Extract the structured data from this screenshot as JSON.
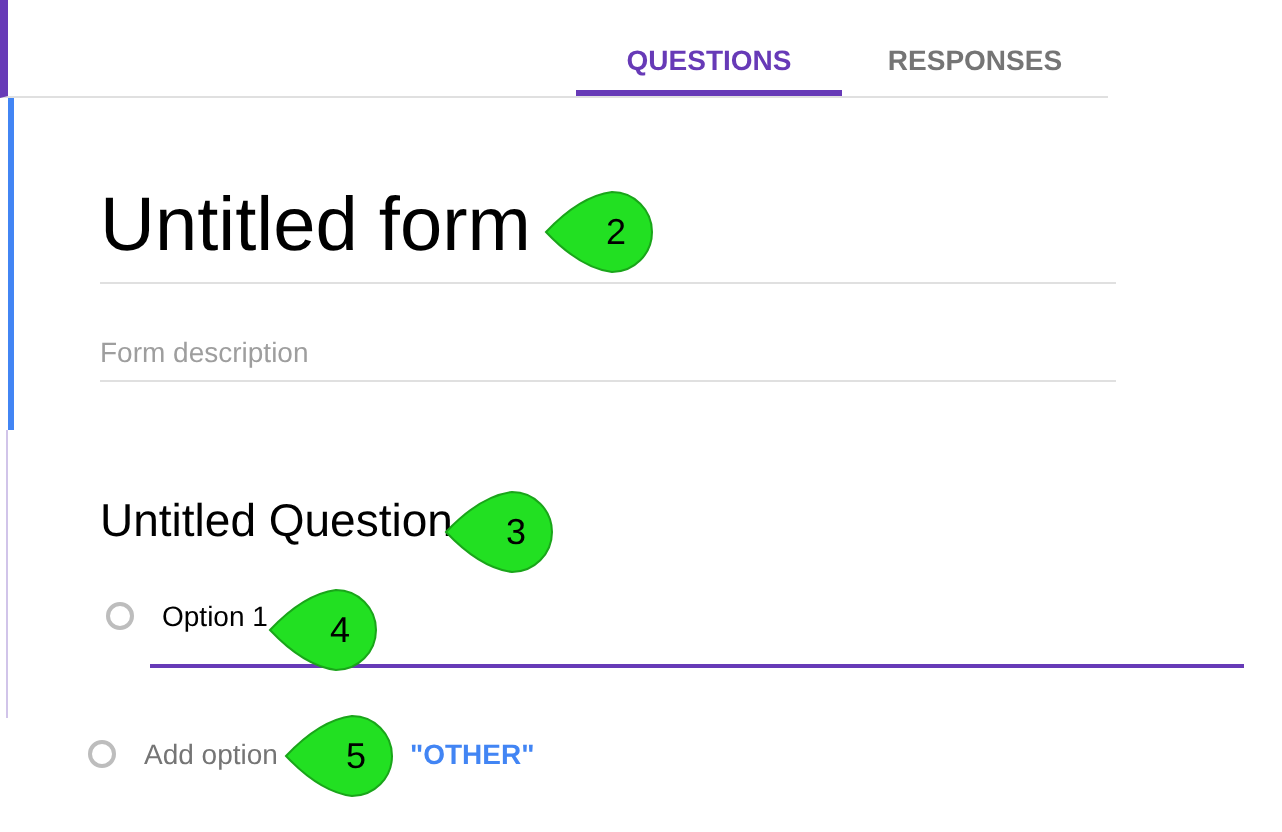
{
  "tabs": [
    {
      "label": "QUESTIONS",
      "selected": true
    },
    {
      "label": "RESPONSES",
      "selected": false
    }
  ],
  "form": {
    "title": "Untitled form",
    "description": {
      "placeholder": "Form description"
    }
  },
  "question": {
    "title": "Untitled Question",
    "options": [
      {
        "label": "Option 1",
        "selected": false
      }
    ],
    "add_option": {
      "selected": false,
      "label": "Add option",
      "other_link": "\"OTHER\""
    }
  },
  "callouts": [
    {
      "number": "2"
    },
    {
      "number": "3"
    },
    {
      "number": "4"
    },
    {
      "number": "5"
    }
  ]
}
